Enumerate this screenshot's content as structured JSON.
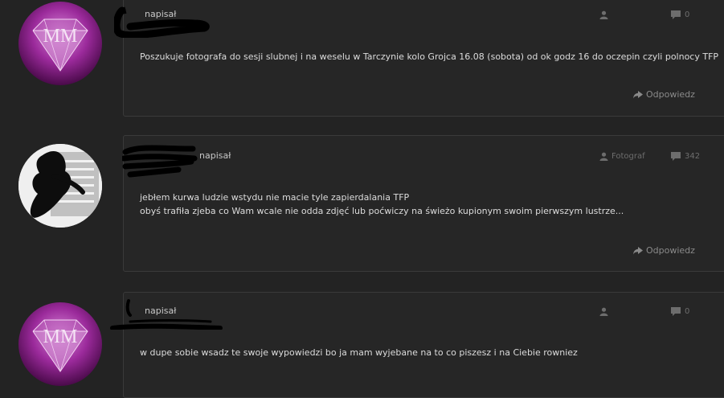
{
  "posts": [
    {
      "author_suffix": "napisał",
      "role": "",
      "count": "0",
      "message_lines": [
        "Poszukuje fotografa do sesji slubnej i na weselu w Tarczynie kolo Grojca 16.08 (sobota) od ok godz 16 do oczepin czyli polnocy TFP"
      ],
      "reply_label": "Odpowiedz",
      "avatar_text": "MM"
    },
    {
      "author_suffix": "napisał",
      "role": "Fotograf",
      "count": "342",
      "message_lines": [
        "jebłem kurwa ludzie wstydu nie macie tyle zapierdalania TFP",
        "obyś trafiła zjeba co Wam wcale nie odda zdjęć lub poćwiczy na świeżo kupionym swoim pierwszym lustrze..."
      ],
      "reply_label": "Odpowiedz"
    },
    {
      "author_suffix": "napisał",
      "role": "",
      "count": "0",
      "message_lines": [
        "w dupe sobie wsadz te swoje wypowiedzi bo ja mam wyjebane na to co piszesz i na Ciebie rowniez"
      ],
      "avatar_text": "MM"
    }
  ],
  "icons": {
    "user": "user-icon",
    "comment": "comment-icon",
    "reply": "reply-arrow-icon"
  },
  "colors": {
    "background": "#232323",
    "card": "#262626",
    "avatar_purple": "#9b2a9b"
  }
}
